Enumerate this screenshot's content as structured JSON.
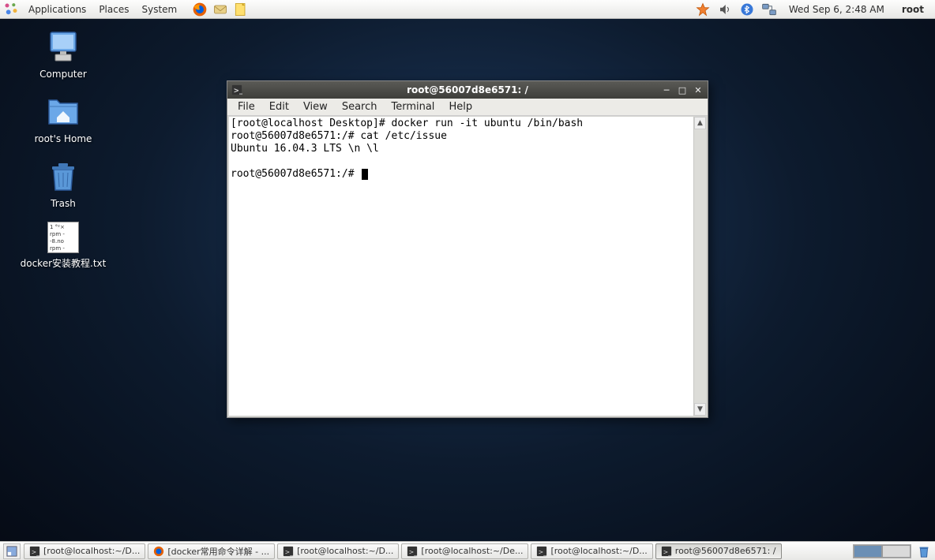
{
  "top_panel": {
    "menus": [
      "Applications",
      "Places",
      "System"
    ],
    "launcher_icons": [
      "firefox-icon",
      "evolution-icon",
      "notes-icon"
    ],
    "tray_icons": [
      "update-icon",
      "volume-icon",
      "bluetooth-icon",
      "network-icon"
    ],
    "clock": "Wed Sep  6,  2:48 AM",
    "user": "root"
  },
  "desktop": {
    "icons": [
      {
        "name": "computer-icon",
        "label": "Computer"
      },
      {
        "name": "home-icon",
        "label": "root's Home"
      },
      {
        "name": "trash-icon",
        "label": "Trash"
      },
      {
        "name": "text-file-icon",
        "label": "docker安装教程.txt",
        "preview": "1 °²×\nrpm -\n-8.no\nrpm -"
      }
    ]
  },
  "terminal": {
    "title": "root@56007d8e6571: /",
    "menus": [
      "File",
      "Edit",
      "View",
      "Search",
      "Terminal",
      "Help"
    ],
    "lines": [
      "[root@localhost Desktop]# docker run -it ubuntu /bin/bash",
      "root@56007d8e6571:/# cat /etc/issue",
      "Ubuntu 16.04.3 LTS \\n \\l",
      "",
      "root@56007d8e6571:/# "
    ]
  },
  "bottom_panel": {
    "tasks": [
      {
        "icon": "terminal-icon",
        "label": "[root@localhost:~/D...",
        "active": false
      },
      {
        "icon": "firefox-icon",
        "label": "[docker常用命令详解 - ...",
        "active": false
      },
      {
        "icon": "terminal-icon",
        "label": "[root@localhost:~/D...",
        "active": false
      },
      {
        "icon": "terminal-icon",
        "label": "[root@localhost:~/De...",
        "active": false
      },
      {
        "icon": "terminal-icon",
        "label": "[root@localhost:~/D...",
        "active": false
      },
      {
        "icon": "terminal-icon",
        "label": "root@56007d8e6571: /",
        "active": true
      }
    ],
    "workspaces": 2,
    "active_workspace": 0
  }
}
